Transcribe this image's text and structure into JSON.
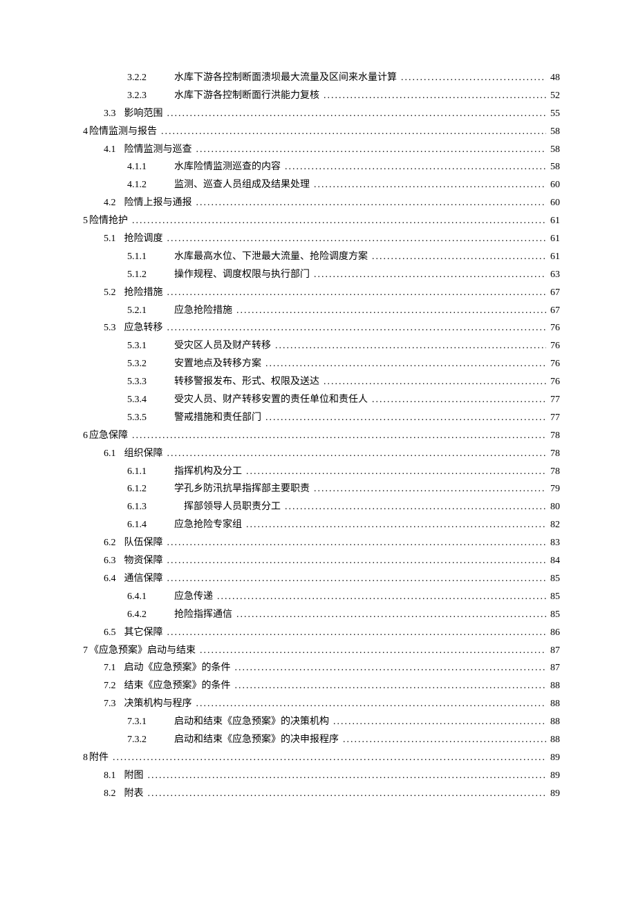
{
  "toc": [
    {
      "level": 3,
      "num": "3.2.2",
      "text": "水库下游各控制断面溃坝最大流量及区间来水量计算",
      "page": "48"
    },
    {
      "level": 3,
      "num": "3.2.3",
      "text": "水库下游各控制断面行洪能力复核",
      "page": "52"
    },
    {
      "level": 2,
      "num": "3.3",
      "text": "影响范围",
      "page": "55"
    },
    {
      "level": 1,
      "num": "4",
      "text": "险情监测与报告",
      "page": "58"
    },
    {
      "level": 2,
      "num": "4.1",
      "text": "险情监测与巡查",
      "page": "58"
    },
    {
      "level": 3,
      "num": "4.1.1",
      "text": "水库险情监测巡查的内容",
      "page": "58"
    },
    {
      "level": 3,
      "num": "4.1.2",
      "text": "监测、巡查人员组成及结果处理",
      "page": "60"
    },
    {
      "level": 2,
      "num": "4.2",
      "text": "险情上报与通报",
      "page": "60"
    },
    {
      "level": 1,
      "num": "5",
      "text": "险情抢护",
      "page": "61"
    },
    {
      "level": 2,
      "num": "5.1",
      "text": "抢险调度",
      "page": "61"
    },
    {
      "level": 3,
      "num": "5.1.1",
      "text": "水库最高水位、下泄最大流量、抢险调度方案",
      "page": "61"
    },
    {
      "level": 3,
      "num": "5.1.2",
      "text": "操作规程、调度权限与执行部门",
      "page": "63"
    },
    {
      "level": 2,
      "num": "5.2",
      "text": "抢险措施",
      "page": "67"
    },
    {
      "level": 3,
      "num": "5.2.1",
      "text": "应急抢险措施",
      "page": "67"
    },
    {
      "level": 2,
      "num": "5.3",
      "text": "应急转移",
      "page": "76"
    },
    {
      "level": 3,
      "num": "5.3.1",
      "text": "受灾区人员及财产转移",
      "page": "76"
    },
    {
      "level": 3,
      "num": "5.3.2",
      "text": "安置地点及转移方案",
      "page": "76"
    },
    {
      "level": 3,
      "num": "5.3.3",
      "text": "转移警报发布、形式、权限及送达",
      "page": "76"
    },
    {
      "level": 3,
      "num": "5.3.4",
      "text": "受灾人员、财产转移安置的责任单位和责任人",
      "page": "77"
    },
    {
      "level": 3,
      "num": "5.3.5",
      "text": "警戒措施和责任部门",
      "page": "77"
    },
    {
      "level": 1,
      "num": "6",
      "text": "应急保障",
      "page": "78"
    },
    {
      "level": 2,
      "num": "6.1",
      "text": "组织保障",
      "page": "78"
    },
    {
      "level": 3,
      "num": "6.1.1",
      "text": "指挥机构及分工",
      "page": "78"
    },
    {
      "level": 3,
      "num": "6.1.2",
      "text": "学孔乡防汛抗旱指挥部主要职责",
      "page": "79"
    },
    {
      "level": 3,
      "num": "6.1.3",
      "text": "　挥部领导人员职责分工",
      "page": "80"
    },
    {
      "level": 3,
      "num": "6.1.4",
      "text": "应急抢险专家组",
      "page": "82"
    },
    {
      "level": 2,
      "num": "6.2",
      "text": "队伍保障",
      "page": "83"
    },
    {
      "level": 2,
      "num": "6.3",
      "text": "物资保障",
      "page": "84"
    },
    {
      "level": 2,
      "num": "6.4",
      "text": "通信保障",
      "page": "85"
    },
    {
      "level": 3,
      "num": "6.4.1",
      "text": "应急传递",
      "page": "85"
    },
    {
      "level": 3,
      "num": "6.4.2",
      "text": "抢险指挥通信",
      "page": "85"
    },
    {
      "level": 2,
      "num": "6.5",
      "text": "其它保障",
      "page": "86"
    },
    {
      "level": 1,
      "num": "7",
      "text": "《应急预案》启动与结束",
      "page": "87"
    },
    {
      "level": 2,
      "num": "7.1",
      "text": "启动《应急预案》的条件",
      "page": "87"
    },
    {
      "level": 2,
      "num": "7.2",
      "text": "结束《应急预案》的条件",
      "page": "88"
    },
    {
      "level": 2,
      "num": "7.3",
      "text": "决策机构与程序",
      "page": "88"
    },
    {
      "level": 3,
      "num": "7.3.1",
      "text": "启动和结束《应急预案》的决策机构",
      "page": "88"
    },
    {
      "level": 3,
      "num": "7.3.2",
      "text": "启动和结束《应急预案》的决申报程序",
      "page": "88"
    },
    {
      "level": 1,
      "num": "8",
      "text": "附件",
      "page": "89"
    },
    {
      "level": 2,
      "num": "8.1",
      "text": "附图",
      "page": "89"
    },
    {
      "level": 2,
      "num": "8.2",
      "text": "附表",
      "page": "89"
    }
  ]
}
